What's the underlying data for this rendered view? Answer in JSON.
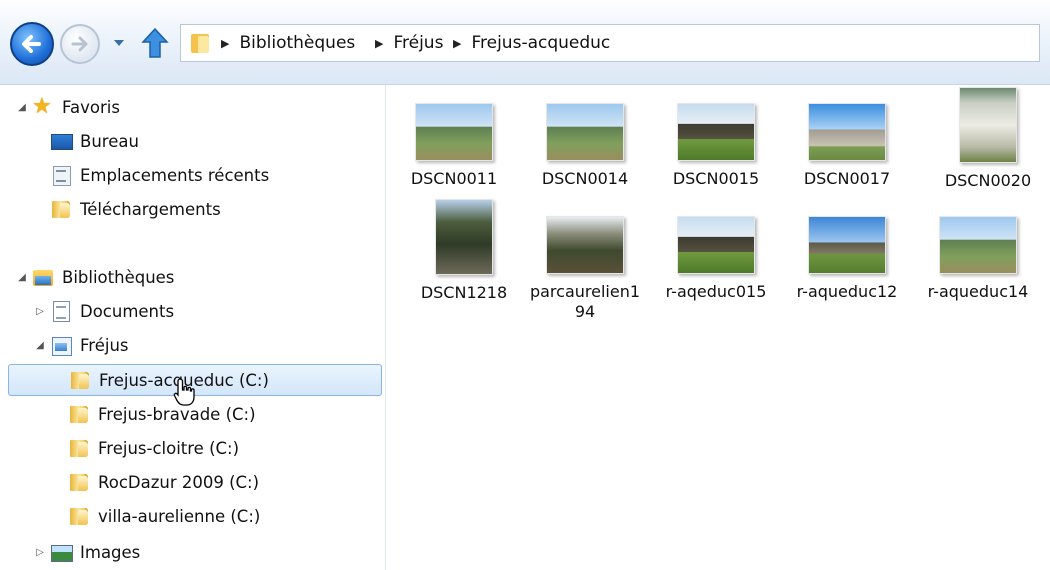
{
  "toolbar": {
    "icons": [
      "back-arrow-icon",
      "forward-arrow-icon",
      "chevron-down-icon",
      "up-arrow-icon",
      "folder-icon"
    ]
  },
  "address_bar": {
    "crumbs": [
      "Bibliothèques",
      "Fréjus",
      "Frejus-acqueduc"
    ]
  },
  "nav_pane": {
    "favorites": {
      "label": "Favoris",
      "items": [
        {
          "label": "Bureau",
          "icon": "desktop-icon"
        },
        {
          "label": "Emplacements récents",
          "icon": "recent-places-icon"
        },
        {
          "label": "Téléchargements",
          "icon": "folder-icon"
        }
      ]
    },
    "libraries": {
      "label": "Bibliothèques",
      "items": [
        {
          "label": "Documents",
          "icon": "documents-icon"
        },
        {
          "label": "Fréjus",
          "icon": "library-folder-icon"
        }
      ],
      "frejus_children": [
        {
          "label": "Frejus-acqueduc (C:)",
          "selected": true
        },
        {
          "label": "Frejus-bravade (C:)"
        },
        {
          "label": "Frejus-cloitre (C:)"
        },
        {
          "label": "RocDazur 2009 (C:)"
        },
        {
          "label": "villa-aurelienne (C:)"
        }
      ],
      "images_label": "Images"
    }
  },
  "files": [
    {
      "label": "DSCN0011",
      "kind": "landscape"
    },
    {
      "label": "DSCN0014",
      "kind": "landscape"
    },
    {
      "label": "DSCN0015",
      "kind": "ruins"
    },
    {
      "label": "DSCN0017",
      "kind": "tower"
    },
    {
      "label": "DSCN0020",
      "kind": "sign"
    },
    {
      "label": "DSCN1218",
      "kind": "tree"
    },
    {
      "label": "parcaurelien194",
      "kind": "forest"
    },
    {
      "label": "r-aqeduc015",
      "kind": "ruins"
    },
    {
      "label": "r-aqueduc12",
      "kind": "ruins2"
    },
    {
      "label": "r-aqueduc14",
      "kind": "landscape"
    }
  ],
  "colors": {
    "selection_bg": "#d3e6fa",
    "selection_border": "#87b5e8",
    "nav_gradient_top": "#fdfeff",
    "nav_gradient_bottom": "#dbe7f5"
  }
}
